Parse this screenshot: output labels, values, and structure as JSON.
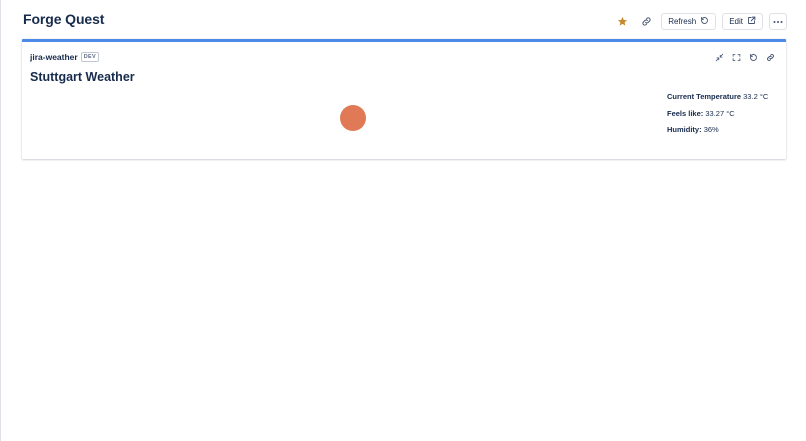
{
  "page": {
    "title": "Forge Quest"
  },
  "header": {
    "refresh_label": "Refresh",
    "edit_label": "Edit",
    "icons": {
      "star": "star-icon",
      "link": "link-icon",
      "refresh": "refresh-icon",
      "edit": "external-edit-icon",
      "more": "more-icon"
    }
  },
  "gadget": {
    "app_name": "jira-weather",
    "env_badge": "DEV",
    "title": "Stuttgart Weather",
    "tools": [
      "collapse-icon",
      "fullscreen-icon",
      "refresh-icon",
      "link-icon"
    ],
    "weather": {
      "temperature_label": "Current Temperature",
      "temperature_value": "33.2 °C",
      "feels_like_label": "Feels like:",
      "feels_like_value": "33.27 °C",
      "humidity_label": "Humidity:",
      "humidity_value": "36%"
    }
  },
  "colors": {
    "accent": "#4d8ae7",
    "star": "#c68a2e",
    "sun": "#e07a56",
    "text": "#172b4d"
  }
}
